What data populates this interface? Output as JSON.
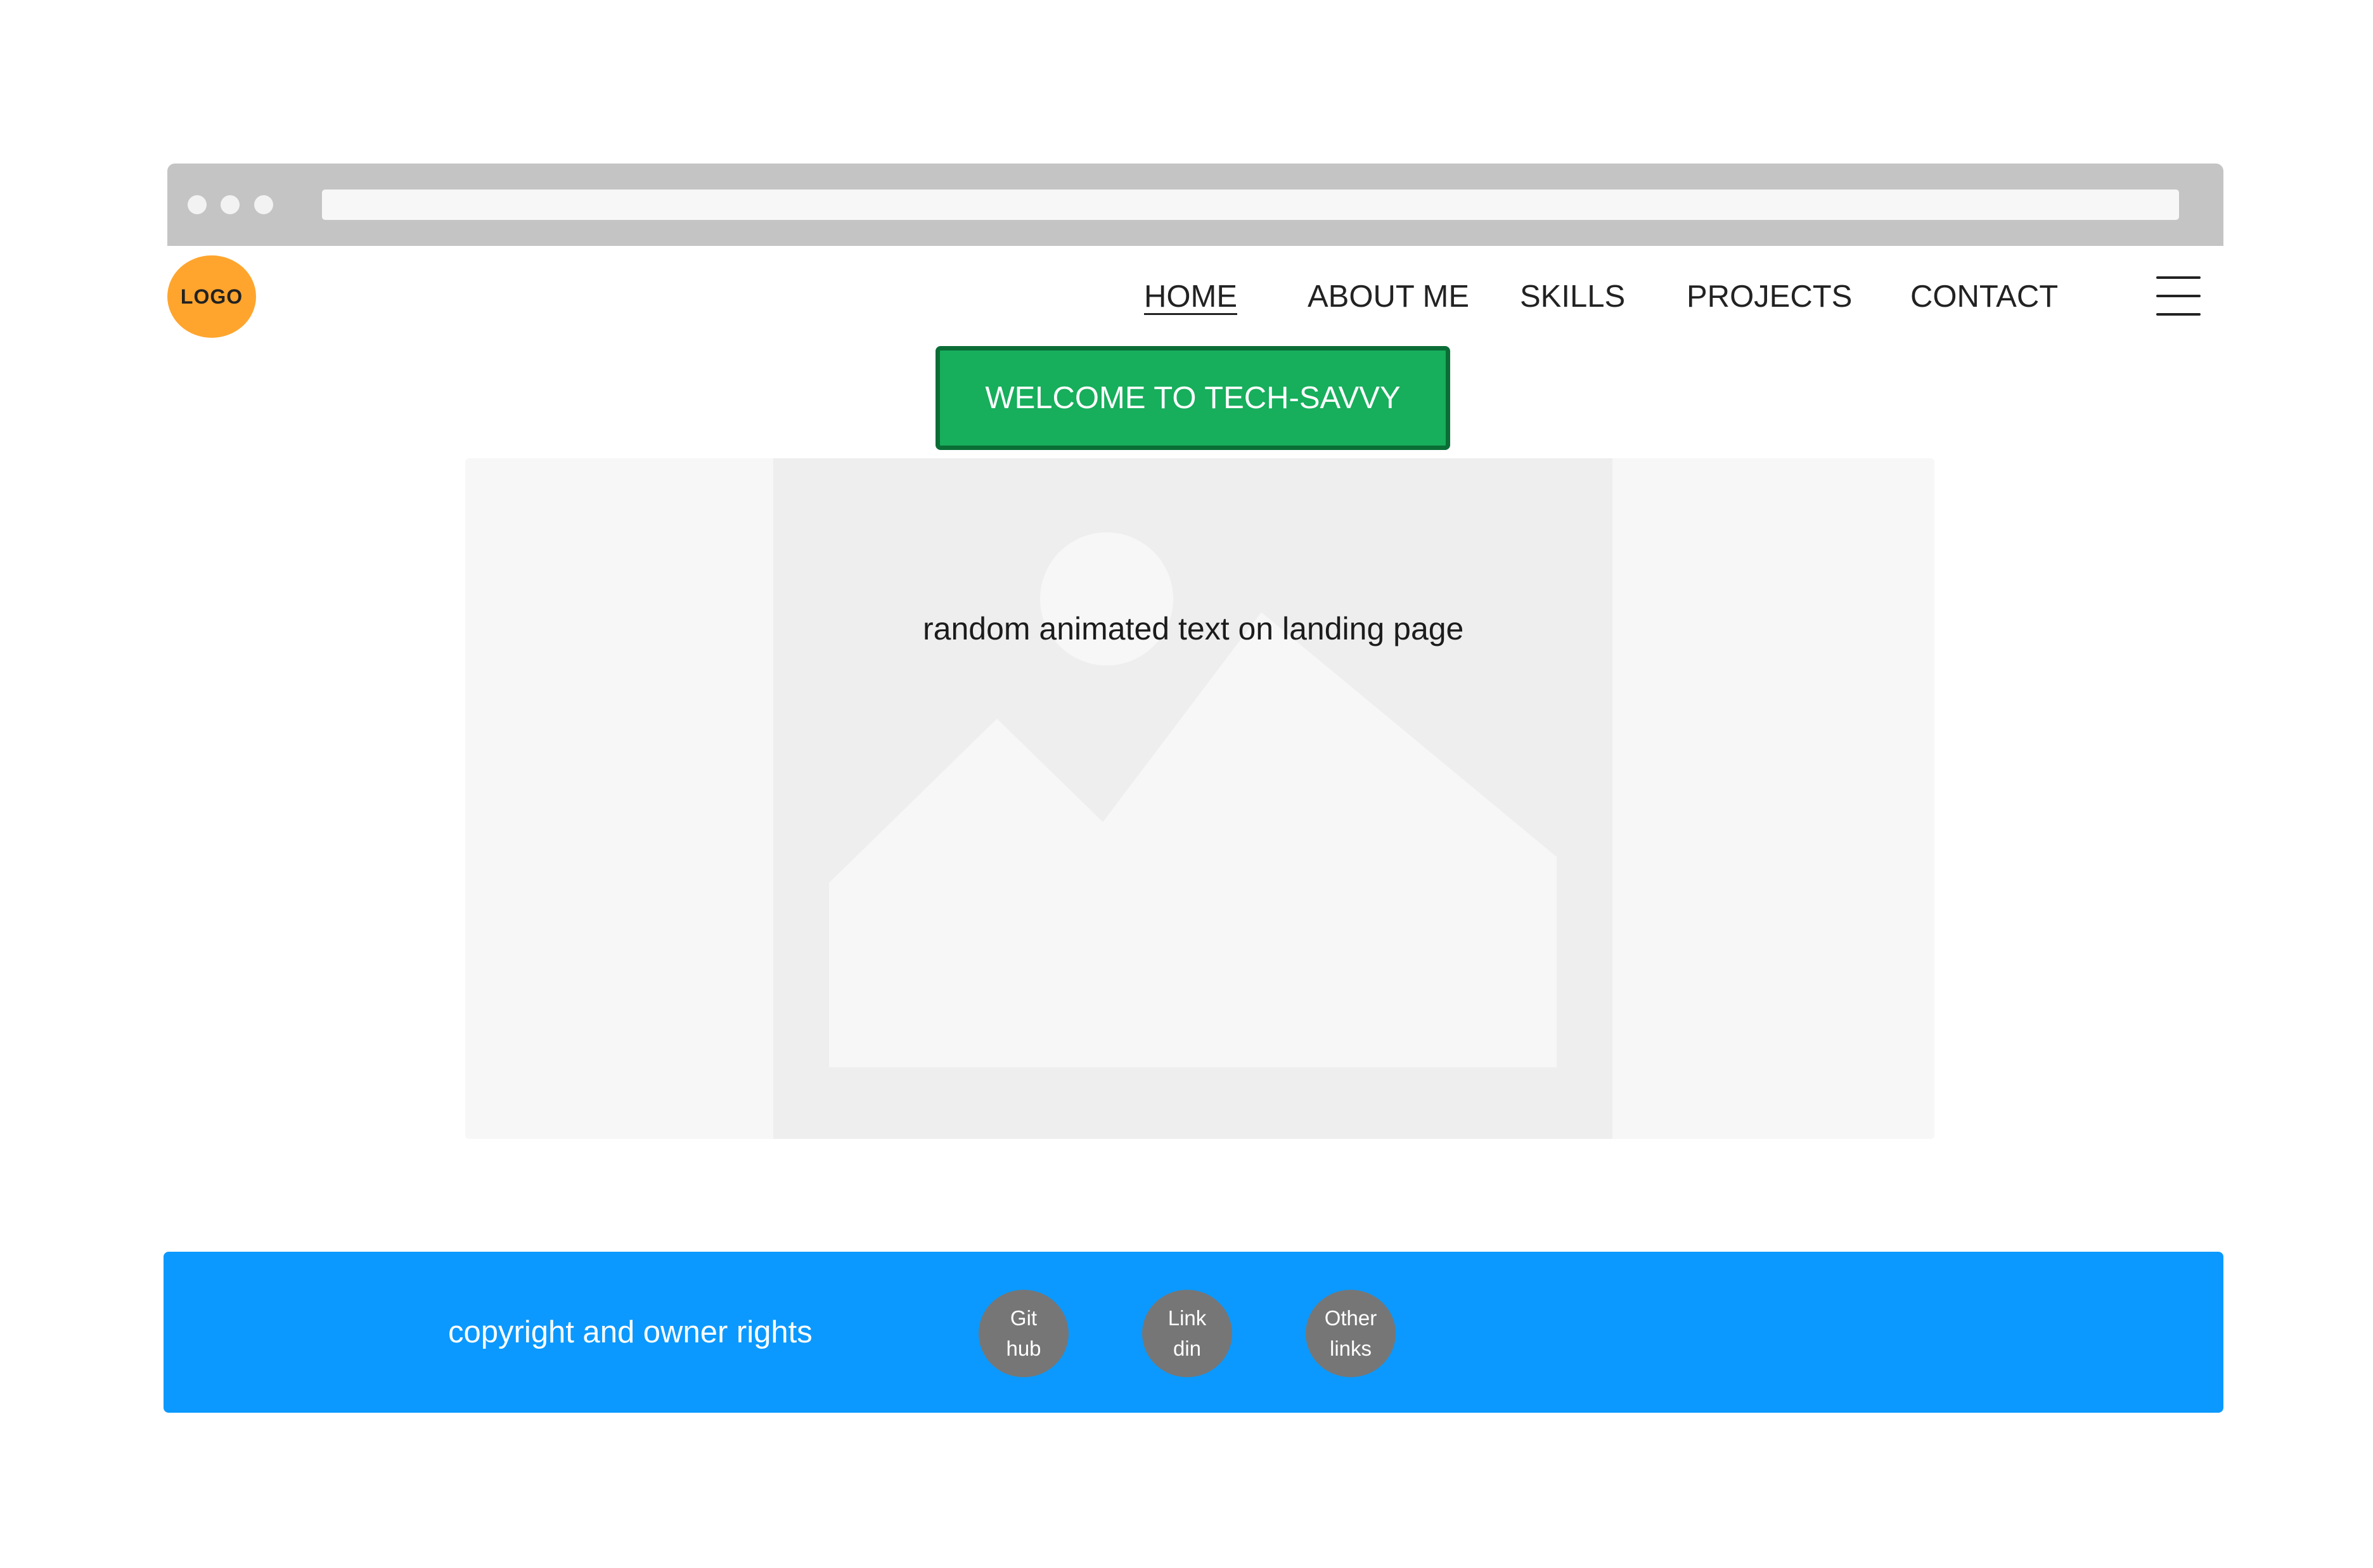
{
  "header": {
    "logo_text": "LOGO",
    "nav": [
      {
        "label": "HOME",
        "active": true
      },
      {
        "label": "ABOUT ME"
      },
      {
        "label": "SKILLS"
      },
      {
        "label": "PROJECTS"
      },
      {
        "label": "CONTACT"
      }
    ],
    "menu_icon": "hamburger-icon"
  },
  "welcome_button": {
    "label": "WELCOME TO TECH-SAVVY"
  },
  "hero": {
    "text": "random animated text on landing page",
    "image_icon": "image-placeholder-icon"
  },
  "footer": {
    "copyright": "copyright and owner rights",
    "links": [
      {
        "line1": "Git",
        "line2": "hub"
      },
      {
        "line1": "Link",
        "line2": "din"
      },
      {
        "line1": "Other",
        "line2": "links"
      }
    ]
  },
  "colors": {
    "logo": "#ffa52d",
    "welcome_button": "#17ae5c",
    "welcome_border": "#0b6d36",
    "footer": "#0b99ff",
    "social_circle": "#767676",
    "browser_bar": "#c4c4c4"
  }
}
